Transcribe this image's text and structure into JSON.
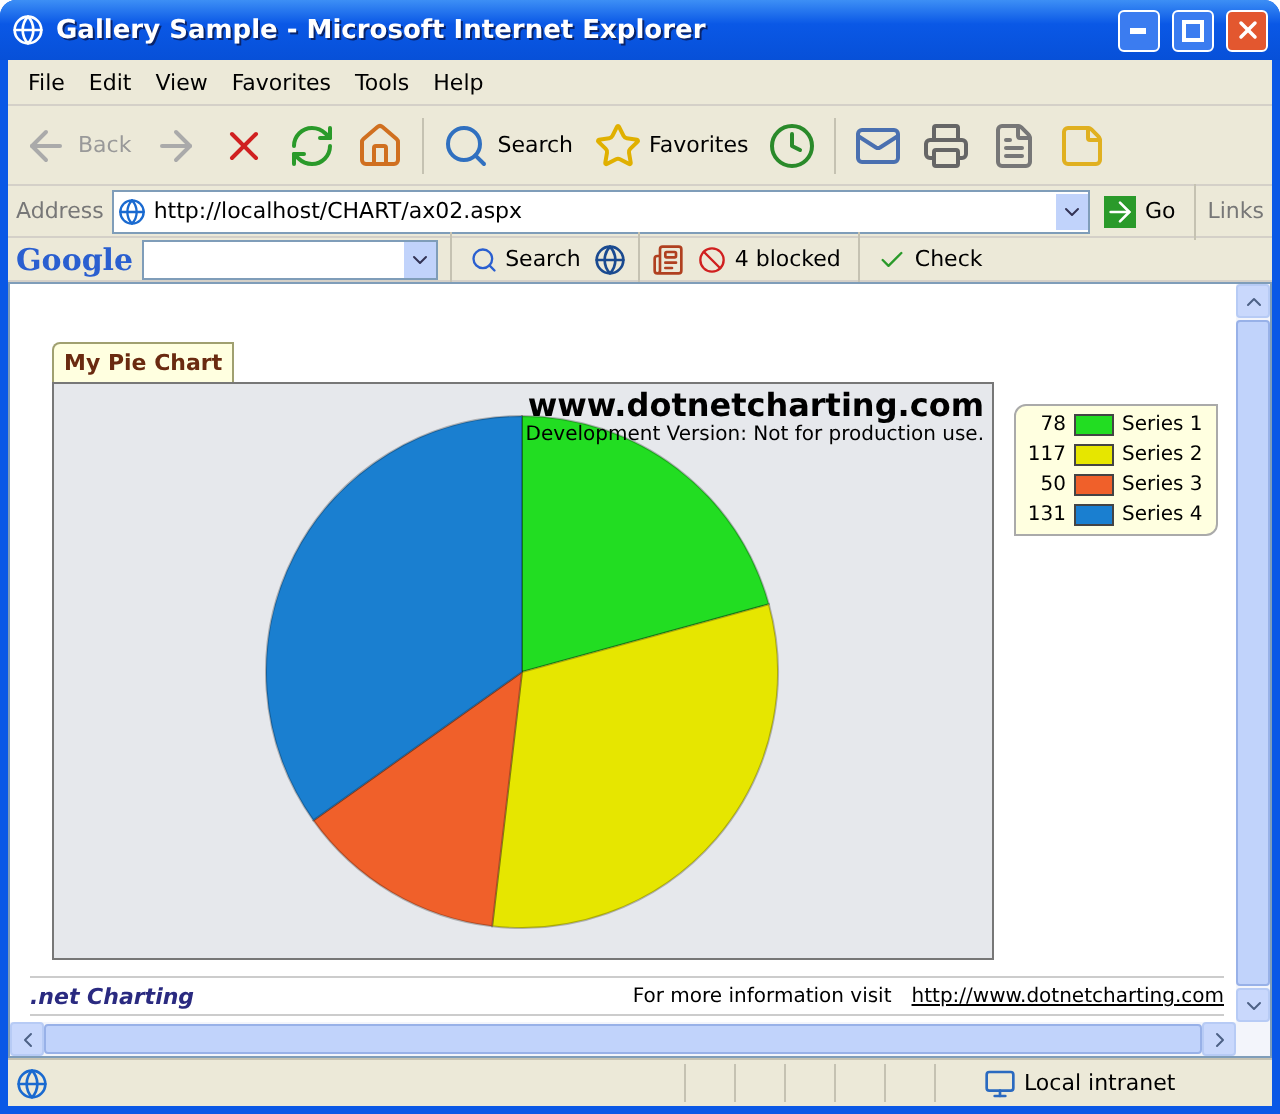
{
  "window": {
    "title": "Gallery Sample - Microsoft Internet Explorer"
  },
  "menu": [
    "File",
    "Edit",
    "View",
    "Favorites",
    "Tools",
    "Help"
  ],
  "toolbar": [
    {
      "kind": "back",
      "label": "Back",
      "disabled": true
    },
    {
      "kind": "forward",
      "disabled": true
    },
    {
      "kind": "stop",
      "disabled": false
    },
    {
      "kind": "refresh",
      "disabled": false
    },
    {
      "kind": "home",
      "disabled": false
    },
    {
      "kind": "search",
      "label": "Search",
      "disabled": false
    },
    {
      "kind": "favorites",
      "label": "Favorites",
      "disabled": false
    },
    {
      "kind": "history",
      "disabled": false
    },
    {
      "kind": "mail",
      "disabled": false
    },
    {
      "kind": "print",
      "disabled": false
    },
    {
      "kind": "word",
      "disabled": false
    },
    {
      "kind": "note",
      "disabled": false
    }
  ],
  "address": {
    "label": "Address",
    "url": "http://localhost/CHART/ax02.aspx",
    "go": "Go",
    "links": "Links"
  },
  "google_bar": {
    "brand": "Google",
    "search": "Search",
    "blocked": "4 blocked",
    "check": "Check"
  },
  "page": {
    "tab": "My Pie Chart",
    "brand": "www.dotnetcharting.com",
    "notice": "Development Version: Not for production use.",
    "chart_data": {
      "type": "pie",
      "values": [
        20.74,
        31.12,
        13.3,
        34.84
      ]
    },
    "legend": [
      {
        "value": "78",
        "label": "Series 1",
        "color": "#22dd22"
      },
      {
        "value": "117",
        "label": "Series 2",
        "color": "#e6e600"
      },
      {
        "value": "50",
        "label": "Series 3",
        "color": "#f0602a"
      },
      {
        "value": "131",
        "label": "Series 4",
        "color": "#1a7fd0"
      }
    ],
    "footer": {
      "logo": ".net Charting",
      "text": "For more information visit",
      "link": "http://www.dotnetcharting.com"
    }
  },
  "status": {
    "zone": "Local intranet"
  }
}
